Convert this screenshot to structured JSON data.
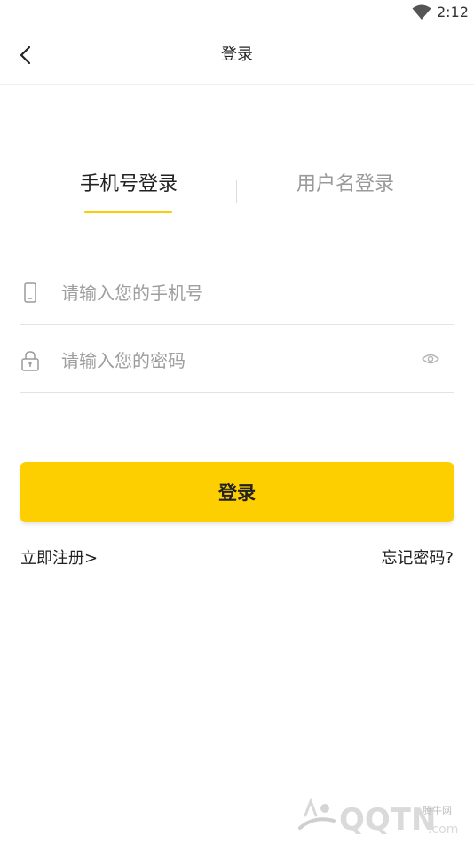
{
  "status_bar": {
    "time": "2:12"
  },
  "nav": {
    "title": "登录"
  },
  "tabs": [
    {
      "label": "手机号登录",
      "active": true
    },
    {
      "label": "用户名登录",
      "active": false
    }
  ],
  "form": {
    "phone_placeholder": "请输入您的手机号",
    "password_placeholder": "请输入您的密码"
  },
  "actions": {
    "login_label": "登录",
    "register_label": "立即注册>",
    "forgot_label": "忘记密码?"
  },
  "watermark": {
    "brand": "QQTN",
    "suffix": ".com",
    "tag": "腾牛网"
  },
  "colors": {
    "accent": "#fecf00",
    "inactive_tab": "#9a9a9a",
    "placeholder": "#9e9e9e"
  },
  "icons": [
    "wifi-icon",
    "back-arrow-icon",
    "phone-icon",
    "lock-icon",
    "eye-icon"
  ]
}
